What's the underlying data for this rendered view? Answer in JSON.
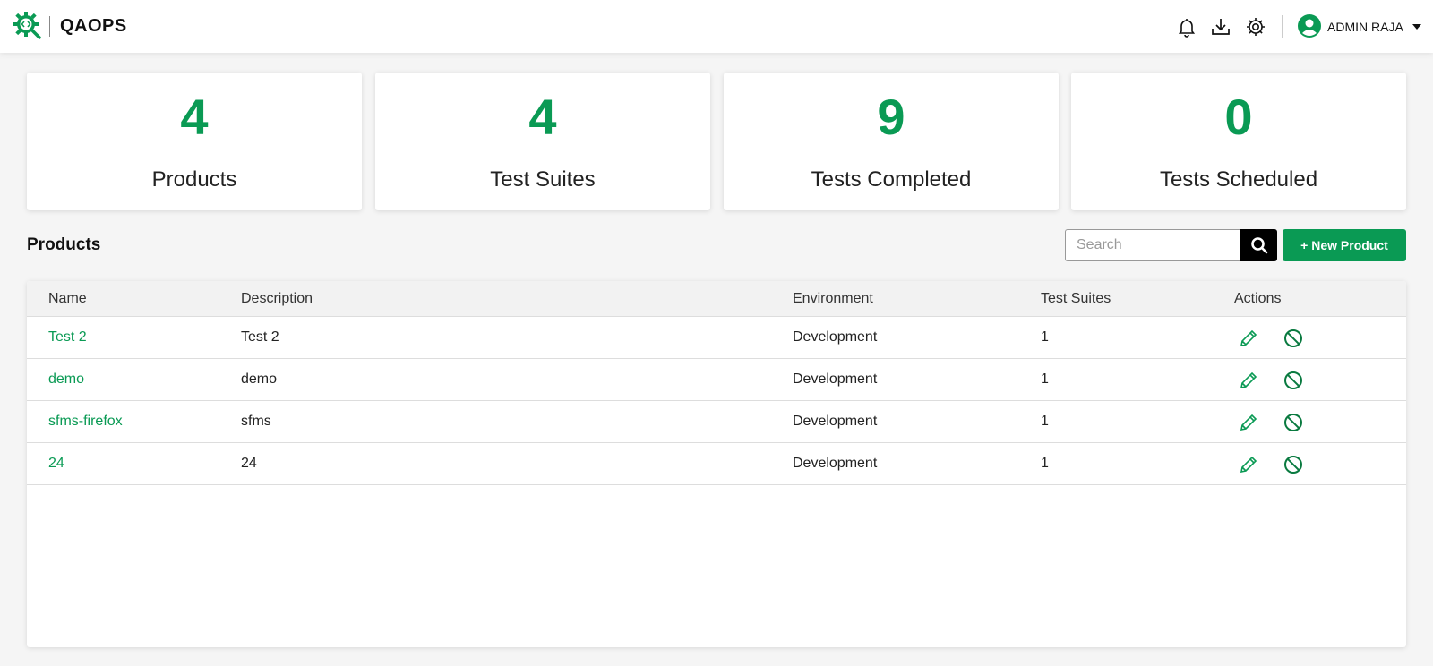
{
  "header": {
    "brand": "QAOPS",
    "logo_icon": "gear-code-search-icon",
    "icons": [
      "bell-icon",
      "download-icon",
      "gear-icon"
    ],
    "user": {
      "name": "ADMIN RAJA",
      "icon": "user-avatar-icon"
    }
  },
  "stats": [
    {
      "value": "4",
      "label": "Products"
    },
    {
      "value": "4",
      "label": "Test Suites"
    },
    {
      "value": "9",
      "label": "Tests Completed"
    },
    {
      "value": "0",
      "label": "Tests Scheduled"
    }
  ],
  "products": {
    "title": "Products",
    "search_placeholder": "Search",
    "search_value": "",
    "new_button": "+ New Product",
    "columns": [
      "Name",
      "Description",
      "Environment",
      "Test Suites",
      "Actions"
    ],
    "rows": [
      {
        "name": "Test 2",
        "description": "Test 2",
        "environment": "Development",
        "test_suites": "1"
      },
      {
        "name": "demo",
        "description": "demo",
        "environment": "Development",
        "test_suites": "1"
      },
      {
        "name": "sfms-firefox",
        "description": "sfms",
        "environment": "Development",
        "test_suites": "1"
      },
      {
        "name": "24",
        "description": "24",
        "environment": "Development",
        "test_suites": "1"
      }
    ],
    "row_actions": [
      "edit-pencil-icon",
      "disable-ban-icon"
    ]
  },
  "colors": {
    "accent": "#0a9a54",
    "search_button": "#000000",
    "header_bg": "#ffffff",
    "page_bg": "#f5f5f5"
  }
}
